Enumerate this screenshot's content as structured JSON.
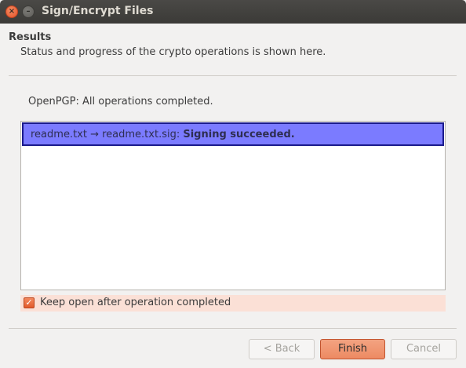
{
  "window": {
    "title": "Sign/Encrypt Files",
    "close_glyph": "×",
    "minimize_glyph": "–"
  },
  "page": {
    "heading": "Results",
    "subheading": "Status and progress of the crypto operations is shown here."
  },
  "status": "OpenPGP: All operations completed.",
  "results": [
    {
      "prefix": "readme.txt → readme.txt.sig: ",
      "outcome": "Signing succeeded.",
      "selected": true
    }
  ],
  "keep_open": {
    "label": "Keep open after operation completed",
    "checked": true,
    "check_glyph": "✓"
  },
  "buttons": {
    "back": "< Back",
    "finish": "Finish",
    "cancel": "Cancel"
  },
  "colors": {
    "accent": "#e95420",
    "selection": "#7b7bff"
  }
}
